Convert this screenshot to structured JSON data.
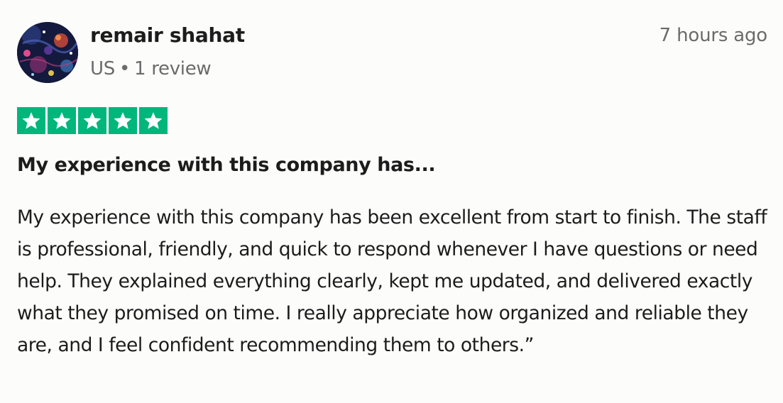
{
  "reviewer": {
    "name": "remair shahat",
    "country": "US",
    "separator": "•",
    "review_count": "1 review"
  },
  "timestamp": "7 hours ago",
  "rating": {
    "value": 5,
    "max": 5,
    "star_color": "#00b67a"
  },
  "review": {
    "title": "My experience with this company has...",
    "body": "My experience with this company has been excellent from start to finish. The staff is professional, friendly, and quick to respond whenever I have questions or need help. They explained everything clearly, kept me updated, and delivered exactly what they promised on time. I really appreciate how organized and reliable they are, and I feel confident recommending them to others.”"
  },
  "icons": {
    "avatar": "avatar-image",
    "star": "star-icon"
  }
}
